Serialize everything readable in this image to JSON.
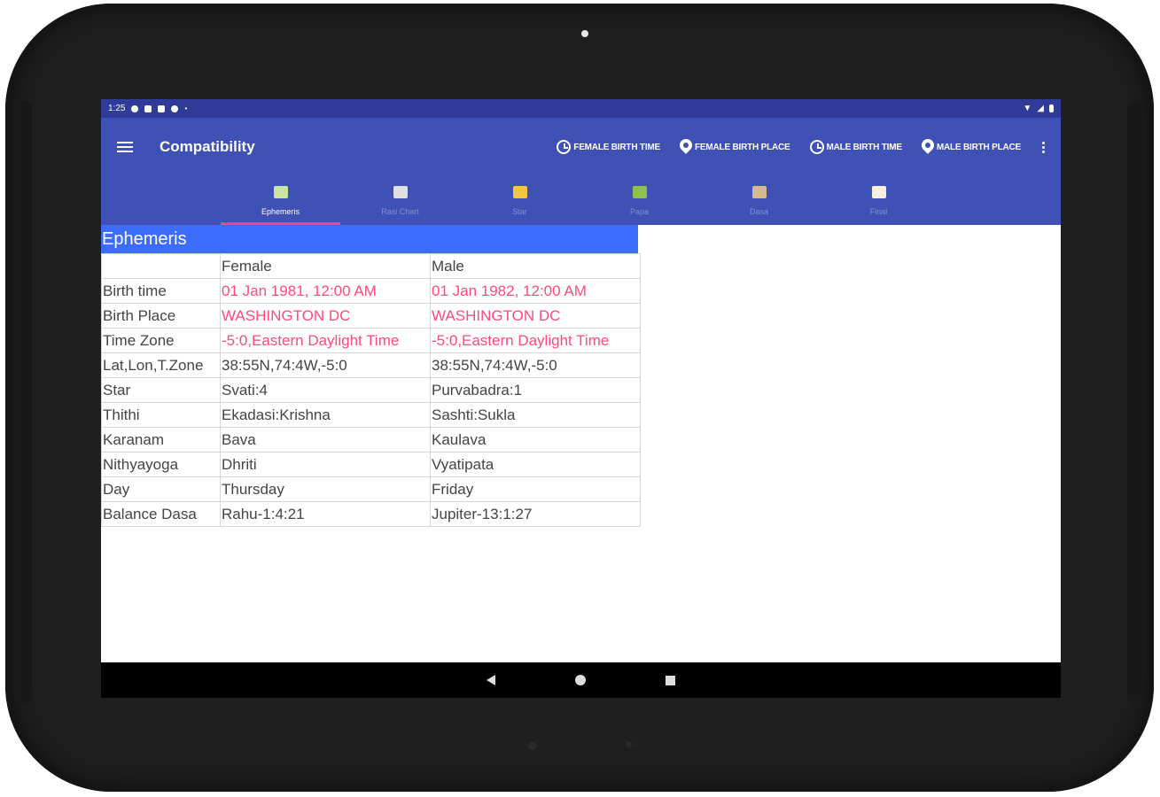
{
  "status_bar": {
    "time": "1:25"
  },
  "app_bar": {
    "title": "Compatibility",
    "actions": [
      {
        "label": "FEMALE BIRTH TIME",
        "icon": "clock-icon"
      },
      {
        "label": "FEMALE BIRTH PLACE",
        "icon": "location-pin-icon"
      },
      {
        "label": "MALE BIRTH TIME",
        "icon": "clock-icon"
      },
      {
        "label": "MALE BIRTH PLACE",
        "icon": "location-pin-icon"
      }
    ]
  },
  "tabs": [
    {
      "label": "Ephemeris",
      "active": true,
      "color": "#c8e6a0"
    },
    {
      "label": "Rasi Chart",
      "active": false,
      "color": "#e0e0e0"
    },
    {
      "label": "Star",
      "active": false,
      "color": "#f4c542"
    },
    {
      "label": "Papa",
      "active": false,
      "color": "#8bc34a"
    },
    {
      "label": "Dasa",
      "active": false,
      "color": "#d7b98e"
    },
    {
      "label": "Final",
      "active": false,
      "color": "#f5f0dc"
    }
  ],
  "ephemeris": {
    "title": "Ephemeris",
    "header": [
      "",
      "Female",
      "Male"
    ],
    "rows": [
      {
        "label": "Birth time",
        "female": "01 Jan 1981, 12:00 AM",
        "male": "01 Jan 1982, 12:00 AM",
        "highlight": true
      },
      {
        "label": "Birth Place",
        "female": "WASHINGTON DC",
        "male": "WASHINGTON DC",
        "highlight": true
      },
      {
        "label": "Time Zone",
        "female": "-5:0,Eastern Daylight Time",
        "male": "-5:0,Eastern Daylight Time",
        "highlight": true
      },
      {
        "label": "Lat,Lon,T.Zone",
        "female": "38:55N,74:4W,-5:0",
        "male": "38:55N,74:4W,-5:0",
        "highlight": false
      },
      {
        "label": "Star",
        "female": "Svati:4",
        "male": "Purvabadra:1",
        "highlight": false
      },
      {
        "label": "Thithi",
        "female": "Ekadasi:Krishna",
        "male": "Sashti:Sukla",
        "highlight": false
      },
      {
        "label": "Karanam",
        "female": "Bava",
        "male": "Kaulava",
        "highlight": false
      },
      {
        "label": "Nithyayoga",
        "female": "Dhriti",
        "male": "Vyatipata",
        "highlight": false
      },
      {
        "label": "Day",
        "female": "Thursday",
        "male": "Friday",
        "highlight": false
      },
      {
        "label": "Balance Dasa",
        "female": "Rahu-1:4:21",
        "male": "Jupiter-13:1:27",
        "highlight": false
      }
    ]
  },
  "colors": {
    "primary": "#3f51b5",
    "primary_dark": "#2f3b99",
    "accent": "#ff4081",
    "table_header": "#3d6bfb",
    "highlight_text": "#ff4a7a"
  },
  "fab": {
    "icon": "share-icon"
  }
}
